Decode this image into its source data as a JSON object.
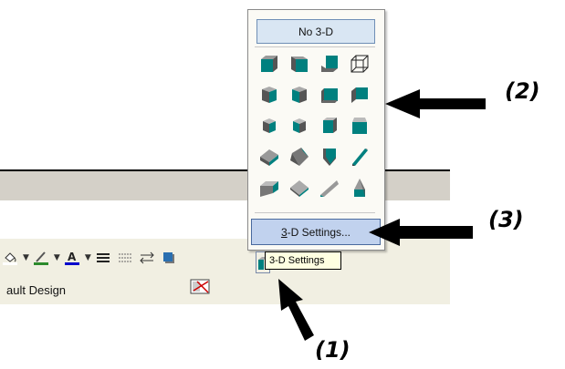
{
  "popup": {
    "no3d_label": "No 3-D",
    "settings_prefix": "3",
    "settings_rest": "-D Settings...",
    "tooltip": "3-D Settings"
  },
  "status": {
    "text": "ault Design"
  },
  "annotations": {
    "label1": "(1)",
    "label2": "(2)",
    "label3": "(3)"
  },
  "colors": {
    "teal": "#00807f",
    "popup_bg": "#fbfaf5",
    "highlight": "#c1d2ee",
    "toolbar": "#f1efe2"
  },
  "toolbar_icons": [
    "fill-color-icon",
    "line-color-icon",
    "font-color-icon",
    "line-style-icon",
    "dash-style-icon",
    "arrow-style-icon",
    "shadow-style-icon",
    "3d-style-icon"
  ],
  "shape_icons": [
    "3d-style-1",
    "3d-style-2",
    "3d-style-3",
    "3d-style-4",
    "3d-style-5",
    "3d-style-6",
    "3d-style-7",
    "3d-style-8",
    "3d-style-9",
    "3d-style-10",
    "3d-style-11",
    "3d-style-12",
    "3d-style-13",
    "3d-style-14",
    "3d-style-15",
    "3d-style-16",
    "3d-style-17",
    "3d-style-18",
    "3d-style-19",
    "3d-style-20"
  ]
}
